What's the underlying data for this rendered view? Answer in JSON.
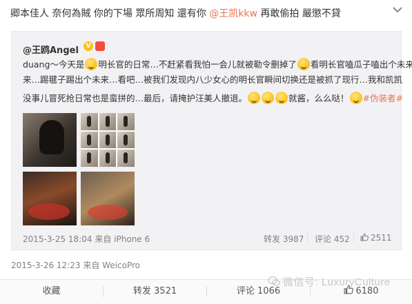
{
  "post": {
    "text_part1": "卿本佳人 奈何為賊  你的下場 眾所周知  還有你 ",
    "mention": "@王凯kkw",
    "text_part2": " 再敢偷拍 嚴懲不貸",
    "timestamp": "2015-3-26 12:23",
    "source_prefix": "来自",
    "source": "WeicoPro"
  },
  "repost": {
    "author": "@王鸥Angel",
    "verified_badge": "V",
    "line1_a": "duang～今天是",
    "line1_b": "明长官的日常…不赶紧看我怕一会儿就被勒令删掉了",
    "line1_c": "看明长官嗑瓜子嗑出个未来",
    "line2": "来…踢毽子踢出个未来…看吧…被我们发现内八少女心的明长官瞬间切换还是被抓了现行…我和凯凯",
    "line3_a": "没事儿冒死抢日常也是蛮拼的…最后，请掩护汪美人撤退。",
    "line3_b": "就酱，么么哒！",
    "line3_tag": "#伪装者#",
    "timestamp": "2015-3-25 18:04",
    "source_prefix": "来自",
    "source": "iPhone 6",
    "repost_label": "转发",
    "repost_count": "3987",
    "comment_label": "评论",
    "comment_count": "452",
    "like_count": "2511"
  },
  "actions": {
    "favorite": "收藏",
    "repost": "转发 3521",
    "comment": "评论 1066",
    "like": "6180"
  },
  "watermark": "微信号: LuxuryCulture",
  "icons": {
    "menu": "chevron-down-icon",
    "like": "thumbs-up-icon",
    "watermark": "wechat-icon"
  },
  "colors": {
    "mention": "#eb7350",
    "meta": "#808080",
    "repost_bg": "#f2f2f5"
  }
}
